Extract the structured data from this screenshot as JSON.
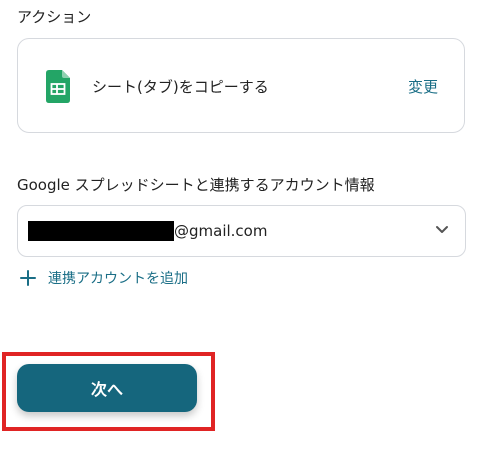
{
  "action": {
    "section_title": "アクション",
    "label": "シート(タブ)をコピーする",
    "change_link": "変更",
    "icon": "google-sheets-icon"
  },
  "account": {
    "section_title": "Google スプレッドシートと連携するアカウント情報",
    "email_suffix": "@gmail.com",
    "add_account_label": "連携アカウントを追加"
  },
  "footer": {
    "next_button_label": "次へ"
  },
  "colors": {
    "accent": "#1a6e86",
    "primary_button": "#15667d",
    "highlight": "#e02424",
    "border": "#d6d9de"
  }
}
